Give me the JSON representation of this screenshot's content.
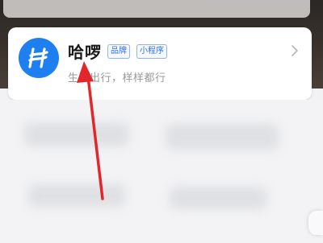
{
  "mini_program_card": {
    "name": "哈啰",
    "tags": [
      "品牌",
      "小程序"
    ],
    "slogan": "生活出行，样样都行",
    "logo_icon": "hello-logo-icon",
    "brand_color": "#1e7ff0"
  },
  "annotation": {
    "arrow_color": "#e3262c",
    "icon": "red-arrow-icon"
  }
}
